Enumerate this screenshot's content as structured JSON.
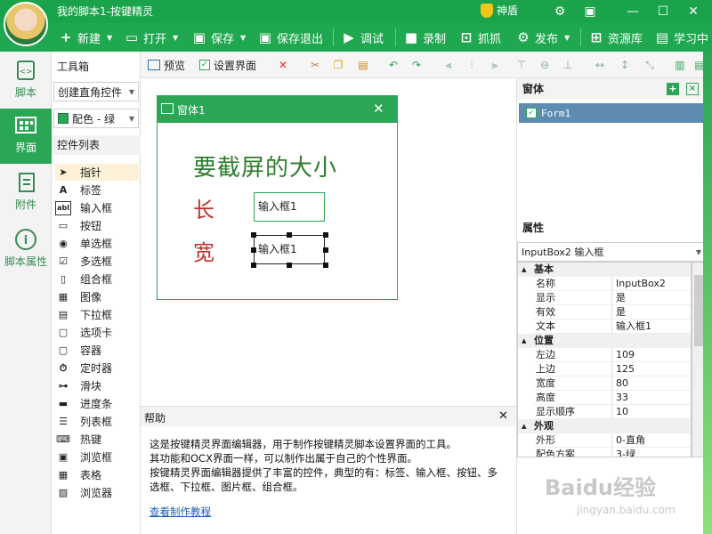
{
  "app": {
    "title": "我的脚本1-按键精灵",
    "shield_label": "神盾"
  },
  "window_controls": {
    "settings": "⚙",
    "skin": "▣",
    "minimize": "—",
    "maximize": "☐",
    "close": "✕"
  },
  "toolbar": {
    "new": "新建",
    "open": "打开",
    "save": "保存",
    "save_exit": "保存退出",
    "debug": "调试",
    "record": "录制",
    "capture": "抓抓",
    "publish": "发布",
    "resources": "资源库",
    "learn": "学习中"
  },
  "leftnav": {
    "script": "脚本",
    "ui": "界面",
    "attach": "附件",
    "script_props": "脚本属性"
  },
  "toolbox": {
    "title": "工具箱",
    "create_mode": "创建直角控件",
    "color_scheme": "配色 - 绿",
    "ctrl_list_title": "控件列表",
    "controls": [
      "指针",
      "标签",
      "输入框",
      "按钮",
      "单选框",
      "多选框",
      "组合框",
      "图像",
      "下拉框",
      "选项卡",
      "容器",
      "定时器",
      "滑块",
      "进度条",
      "列表框",
      "热键",
      "浏览框",
      "表格",
      "浏览器"
    ]
  },
  "subbar": {
    "preview": "预览",
    "settings_ui": "设置界面"
  },
  "form": {
    "title": "窗体1",
    "close": "✕",
    "label_main": "要截屏的大小",
    "label_length": "长",
    "label_width": "宽",
    "input1": "输入框1",
    "input2": "输入框1"
  },
  "help": {
    "title": "帮助",
    "close": "✕",
    "line1": "这是按键精灵界面编辑器，用于制作按键精灵脚本设置界面的工具。",
    "line2": "其功能和OCX界面一样，可以制作出属于自己的个性界面。",
    "line3": "按键精灵界面编辑器提供了丰富的控件，典型的有：标签、输入框、按钮、多选框、下拉框、图片框、组合框。",
    "link": "查看制作教程"
  },
  "right": {
    "form_panel_title": "窗体",
    "form_item": "Form1",
    "props_title": "属性",
    "selected_object": "InputBox2  输入框",
    "props": [
      {
        "cat": "基本"
      },
      {
        "k": "名称",
        "v": "InputBox2"
      },
      {
        "k": "显示",
        "v": "是"
      },
      {
        "k": "有效",
        "v": "是"
      },
      {
        "k": "文本",
        "v": "输入框1"
      },
      {
        "cat": "位置"
      },
      {
        "k": "左边",
        "v": "109"
      },
      {
        "k": "上边",
        "v": "125"
      },
      {
        "k": "宽度",
        "v": "80"
      },
      {
        "k": "高度",
        "v": "33"
      },
      {
        "k": "显示顺序",
        "v": "10"
      },
      {
        "cat": "外观"
      },
      {
        "k": "外形",
        "v": "0-直角"
      },
      {
        "k": "配色方案",
        "v": "3-绿"
      }
    ]
  },
  "watermark": {
    "main": "Baidu经验",
    "sub": "jingyan.baidu.com"
  },
  "colors": {
    "brand_green": "#1aa34a",
    "accent_green": "#2aa655",
    "label_red": "#c0302b",
    "label_green": "#2d7d2d"
  }
}
